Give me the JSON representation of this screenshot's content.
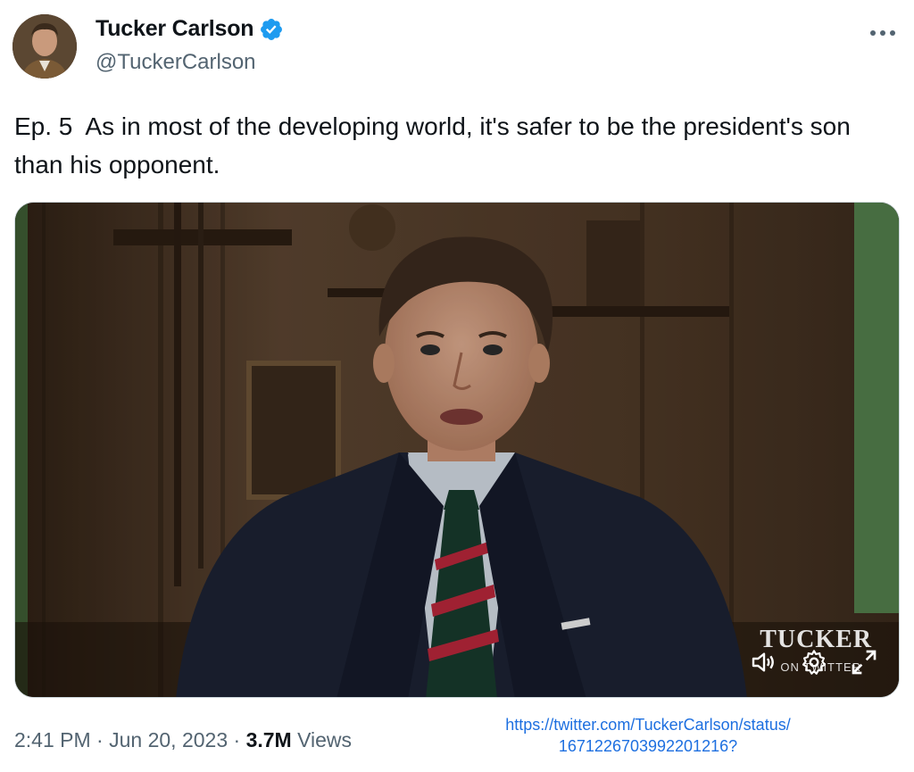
{
  "author": {
    "display_name": "Tucker Carlson",
    "handle": "@TuckerCarlson",
    "verified": true,
    "verified_color": "#1d9bf0",
    "avatar_icon": "profile-photo"
  },
  "menu": {
    "more_icon": "more-horizontal-icon"
  },
  "tweet": {
    "text": "Ep. 5  As in most of the developing world, it's safer to be the president's son than his opponent."
  },
  "media": {
    "type": "video",
    "watermark": "TUCKER",
    "watermark_sub": "ON TWITTER",
    "controls": [
      "volume-icon",
      "settings-icon",
      "fullscreen-icon"
    ]
  },
  "footer": {
    "time": "2:41 PM",
    "separator": "·",
    "date": "Jun 20, 2023",
    "views_count": "3.7M",
    "views_label": "Views",
    "source_url_line1": "https://twitter.com/TuckerCarlson/status/",
    "source_url_line2": "1671226703992201216?"
  },
  "colors": {
    "text_primary": "#0f1419",
    "text_secondary": "#536471",
    "link": "#1d6fe0"
  }
}
